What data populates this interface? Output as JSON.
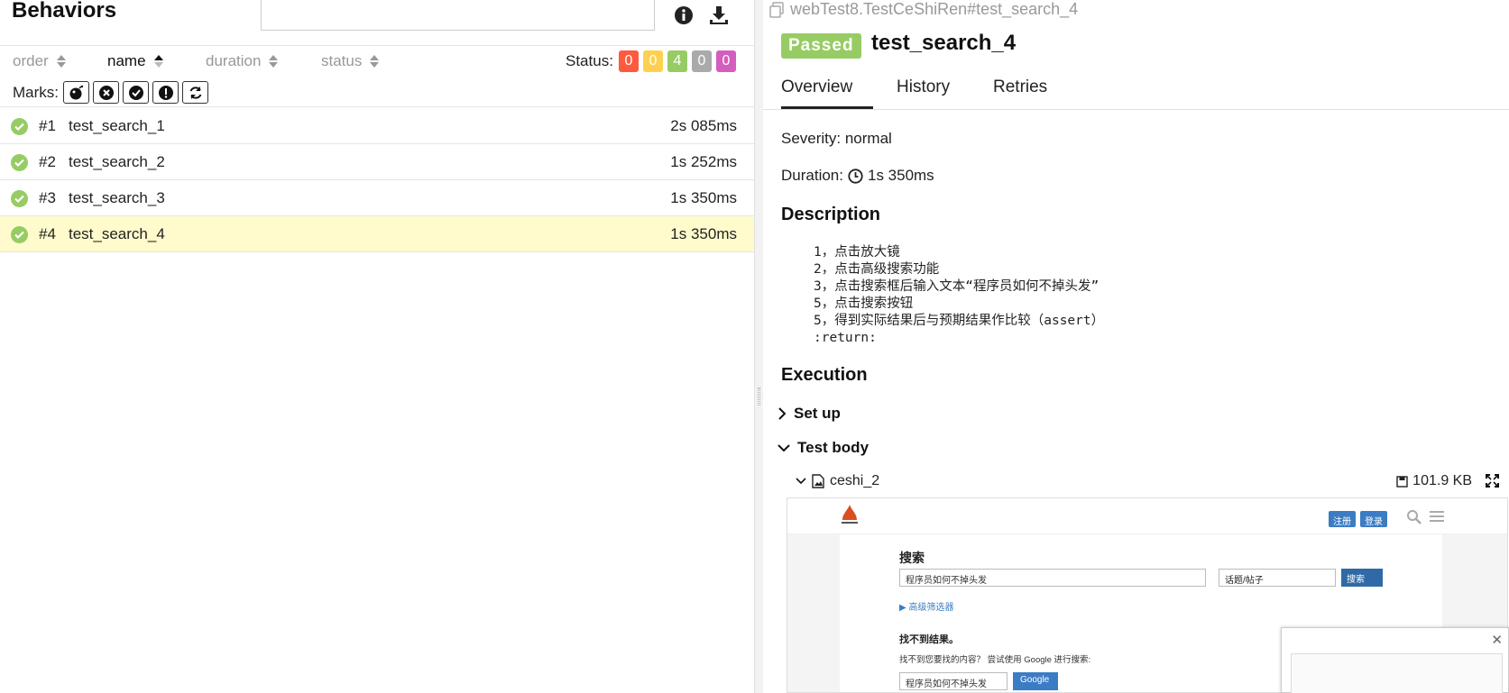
{
  "left": {
    "title": "Behaviors",
    "sort": {
      "order": "order",
      "name": "name",
      "duration": "duration",
      "status": "status"
    },
    "status_label": "Status:",
    "status_counts": [
      {
        "value": "0",
        "color": "#fd5a3e"
      },
      {
        "value": "0",
        "color": "#ffd050"
      },
      {
        "value": "4",
        "color": "#97cc64"
      },
      {
        "value": "0",
        "color": "#aaaaaa"
      },
      {
        "value": "0",
        "color": "#d35ebe"
      }
    ],
    "marks_label": "Marks:",
    "marks": [
      "bomb-icon",
      "times-circle-icon",
      "check-circle-icon",
      "exclamation-circle-icon",
      "refresh-icon"
    ],
    "tests": [
      {
        "num": "#1",
        "name": "test_search_1",
        "duration": "2s 085ms"
      },
      {
        "num": "#2",
        "name": "test_search_2",
        "duration": "1s 252ms"
      },
      {
        "num": "#3",
        "name": "test_search_3",
        "duration": "1s 350ms"
      },
      {
        "num": "#4",
        "name": "test_search_4",
        "duration": "1s 350ms"
      }
    ]
  },
  "right": {
    "path": "webTest8.TestCeShiRen#test_search_4",
    "status_badge": "Passed",
    "title": "test_search_4",
    "tabs": [
      "Overview",
      "History",
      "Retries"
    ],
    "severity": "Severity: normal",
    "duration_label": "Duration:",
    "duration_value": "1s 350ms",
    "description_heading": "Description",
    "description": "1，点击放大镜\n2，点击高级搜索功能\n3，点击搜索框后输入文本“程序员如何不掉头发”\n5，点击搜索按钮\n5，得到实际结果后与预期结果作比较（assert）\n:return:",
    "execution_heading": "Execution",
    "set_up": "Set up",
    "test_body": "Test body",
    "attachment": {
      "name": "ceshi_2",
      "size": "101.9 KB"
    },
    "preview": {
      "btn_register": "注册",
      "btn_login": "登录",
      "heading": "搜索",
      "query": "程序员如何不掉头发",
      "select": "话题/帖子",
      "search_btn": "搜索",
      "advanced": "▶ 高级筛选器",
      "no_results": "找不到结果。",
      "hint": "找不到您要找的内容？ 尝试使用 Google 进行搜索:",
      "google_query": "程序员如何不掉头发",
      "google_btn": "Google"
    }
  }
}
